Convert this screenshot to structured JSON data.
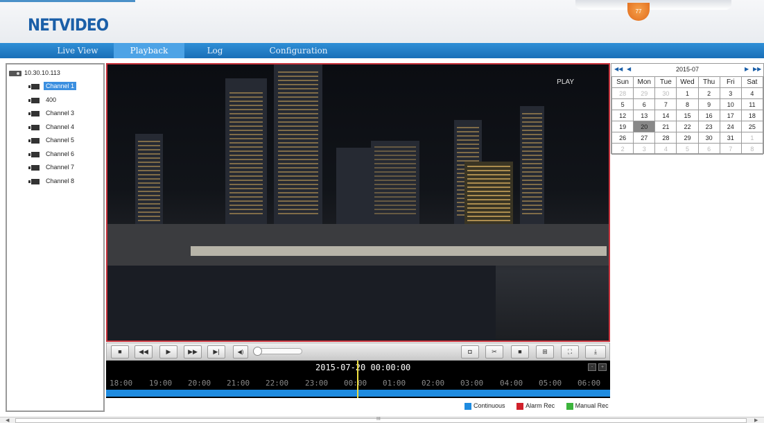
{
  "header": {
    "logo": "NETVIDEO",
    "notification_count": "77"
  },
  "nav": {
    "tabs": [
      {
        "label": "Live View"
      },
      {
        "label": "Playback"
      },
      {
        "label": "Log"
      },
      {
        "label": "Configuration"
      }
    ],
    "active": "Playback"
  },
  "device_tree": {
    "device": "10.30.10.113",
    "channels": [
      {
        "label": "Channel 1",
        "selected": true
      },
      {
        "label": "400"
      },
      {
        "label": "Channel 3"
      },
      {
        "label": "Channel 4"
      },
      {
        "label": "Channel 5"
      },
      {
        "label": "Channel 6"
      },
      {
        "label": "Channel 7"
      },
      {
        "label": "Channel 8"
      }
    ]
  },
  "video": {
    "status": "PLAY"
  },
  "controls": {
    "stop": "■",
    "rewind": "◀◀",
    "play": "▶",
    "fast_forward": "▶▶",
    "step": "▶|",
    "volume_icon": "◀)",
    "snapshot": "◘",
    "clip": "✂",
    "single_view": "■",
    "quad_view": "⊞",
    "fullscreen": "⛶",
    "download": "⤓"
  },
  "timeline": {
    "datetime": "2015-07-20 00:00:00",
    "ticks": [
      "18:00",
      "19:00",
      "20:00",
      "21:00",
      "22:00",
      "23:00",
      "00:00",
      "01:00",
      "02:00",
      "03:00",
      "04:00",
      "05:00",
      "06:00"
    ],
    "zoom_out": "-",
    "zoom_in": "+"
  },
  "legend": [
    {
      "label": "Continuous",
      "color": "#1e8be0"
    },
    {
      "label": "Alarm Rec",
      "color": "#d0202a"
    },
    {
      "label": "Manual Rec",
      "color": "#3cb43c"
    }
  ],
  "calendar": {
    "title": "2015-07",
    "prev_year": "◀◀",
    "prev_month": "◀",
    "next_month": "▶",
    "next_year": "▶▶",
    "weekdays": [
      "Sun",
      "Mon",
      "Tue",
      "Wed",
      "Thu",
      "Fri",
      "Sat"
    ],
    "weeks": [
      [
        "28",
        "29",
        "30",
        "1",
        "2",
        "3",
        "4"
      ],
      [
        "5",
        "6",
        "7",
        "8",
        "9",
        "10",
        "11"
      ],
      [
        "12",
        "13",
        "14",
        "15",
        "16",
        "17",
        "18"
      ],
      [
        "19",
        "20",
        "21",
        "22",
        "23",
        "24",
        "25"
      ],
      [
        "26",
        "27",
        "28",
        "29",
        "30",
        "31",
        "1"
      ],
      [
        "2",
        "3",
        "4",
        "5",
        "6",
        "7",
        "8"
      ]
    ],
    "selected": "20"
  },
  "scrollbar": {
    "grip": "III"
  }
}
